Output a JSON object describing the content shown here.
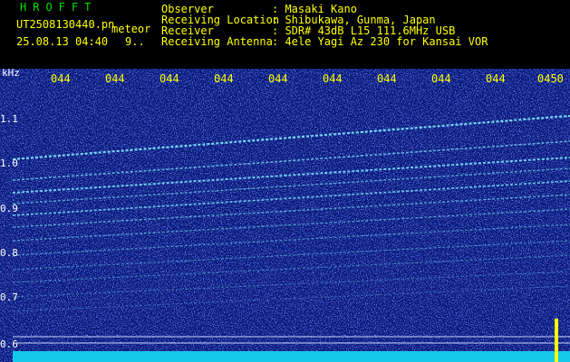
{
  "header": {
    "app_name": "HROFFT",
    "file_name": "UT2508130440.pn",
    "type_label": "meteor",
    "timestamp": "25.08.13 04:40",
    "count": "9..",
    "fields": [
      {
        "label": "Observer",
        "value": ": Masaki Kano"
      },
      {
        "label": "Receiving Location",
        "value": ": Shibukawa, Gunma, Japan"
      },
      {
        "label": "Receiver",
        "value": ": SDR# 43dB L15 111.6MHz USB"
      },
      {
        "label": "Receiving Antenna",
        "value": ": 4ele Yagi Az 230 for Kansai VOR"
      }
    ]
  },
  "spectrogram": {
    "unit_label": "kHz",
    "time_ticks": [
      "044",
      "044",
      "044",
      "044",
      "044",
      "044",
      "044",
      "044",
      "044",
      "0450"
    ],
    "freq_ticks": [
      "1.1",
      "1.0",
      "0.9",
      "0.8",
      "0.7",
      "0.6"
    ],
    "colors": {
      "background": "#0a1a7a",
      "noise": "#3355ff",
      "trace": "#7fe8ff",
      "text": "#ffff00"
    }
  }
}
